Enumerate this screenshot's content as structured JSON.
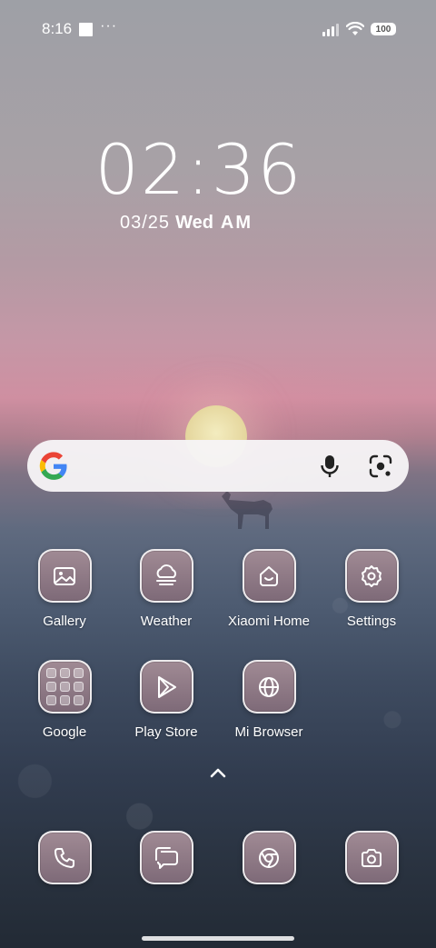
{
  "status_bar": {
    "time": "8:16",
    "dots": "···",
    "battery": "100",
    "icons": [
      "notification-square-icon",
      "signal-icon",
      "wifi-icon",
      "battery-icon"
    ]
  },
  "clock": {
    "time": "02:36",
    "date": "03/25",
    "weekday": "Wed",
    "ampm": "AM"
  },
  "search": {
    "icons": [
      "google-logo",
      "microphone-icon",
      "google-lens-icon"
    ]
  },
  "apps": [
    {
      "label": "Gallery",
      "icon": "gallery-icon"
    },
    {
      "label": "Weather",
      "icon": "weather-icon"
    },
    {
      "label": "Xiaomi Home",
      "icon": "xiaomi-home-icon"
    },
    {
      "label": "Settings",
      "icon": "settings-icon"
    },
    {
      "label": "Google",
      "icon": "google-folder-icon"
    },
    {
      "label": "Play Store",
      "icon": "play-store-icon"
    },
    {
      "label": "Mi Browser",
      "icon": "mi-browser-icon"
    }
  ],
  "dock": [
    {
      "icon": "phone-icon"
    },
    {
      "icon": "messages-icon"
    },
    {
      "icon": "chrome-icon"
    },
    {
      "icon": "camera-icon"
    }
  ]
}
